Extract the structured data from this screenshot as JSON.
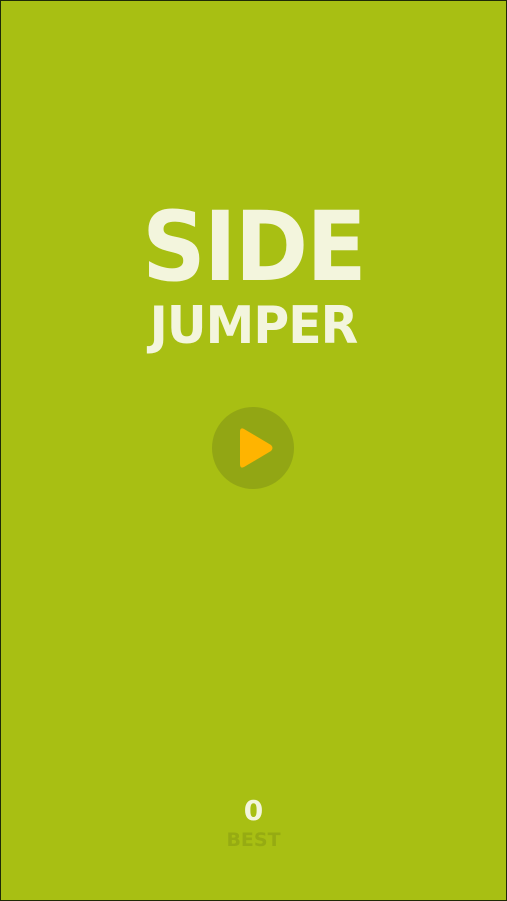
{
  "game": {
    "title_line1": "SIDE",
    "title_line2": "JUMPER"
  },
  "play_button": {
    "icon": "play-icon",
    "icon_color": "#ffb400"
  },
  "score": {
    "best_value": "0",
    "best_label": "BEST"
  },
  "colors": {
    "background": "#a8bf13",
    "title_text": "#f3f5dd",
    "button_circle": "#92a614",
    "best_label": "#96ab12"
  }
}
